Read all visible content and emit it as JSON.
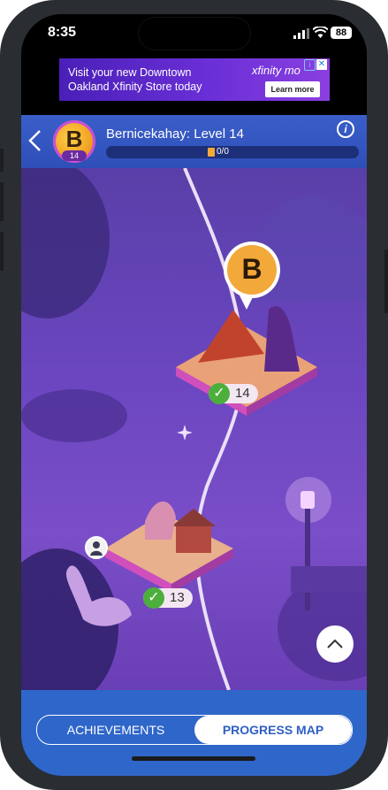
{
  "status_bar": {
    "time": "8:35",
    "battery": "88"
  },
  "ad": {
    "text": "Visit your new Downtown Oakland Xfinity Store today",
    "brand": "xfinity mo",
    "button": "Learn more",
    "close": "✕",
    "info": "i"
  },
  "header": {
    "avatar_letter": "B",
    "avatar_level": "14",
    "player_title": "Bernicekahay: Level 14",
    "progress_text": "0/0",
    "progress": 0,
    "info": "i"
  },
  "map": {
    "marker_letter": "B",
    "levels": [
      {
        "number": "14"
      },
      {
        "number": "13"
      }
    ]
  },
  "tabs": {
    "achievements": "ACHIEVEMENTS",
    "progress_map": "PROGRESS MAP",
    "active": "progress_map"
  },
  "colors": {
    "header": "#3a5ec9",
    "footer": "#2f66c9",
    "progress_fill": "#f2a93a",
    "check": "#4caf3c",
    "map_bg": "#6b46c0"
  }
}
